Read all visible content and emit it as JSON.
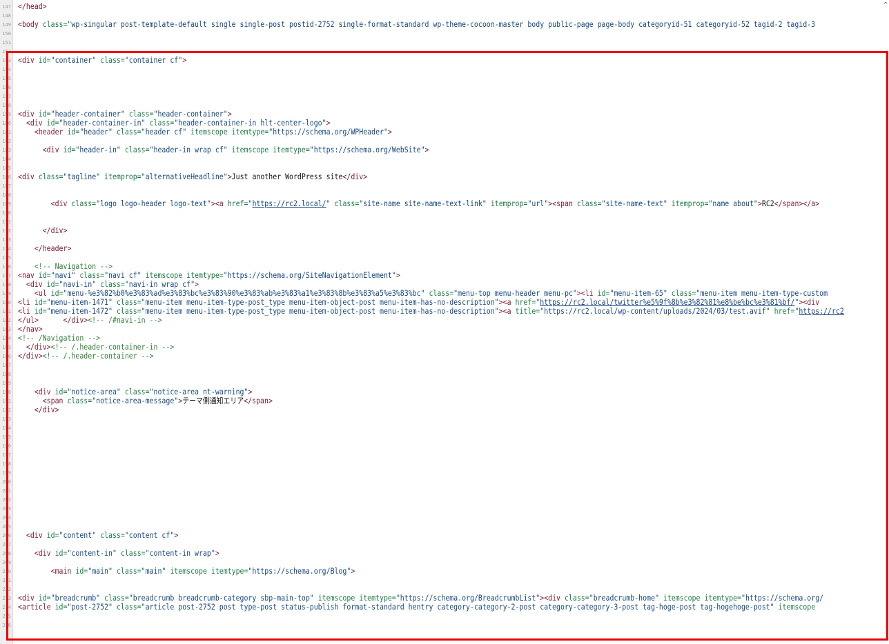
{
  "editor": {
    "highlight_color": "#ee0000",
    "colors": {
      "tag": "#7a1a2e",
      "attr": "#1c7a46",
      "value": "#17477e",
      "comment": "#2f7d35",
      "text": "#111111"
    },
    "scroll_indicator": "^",
    "line_numbers": [
      "147",
      "148",
      "149",
      "150",
      "151",
      "152",
      "153",
      "154",
      "155",
      "156",
      "157",
      "158",
      "159",
      "160",
      "161",
      "162",
      "163",
      "164",
      "165",
      "166",
      "167",
      "168",
      "169",
      "170",
      "171",
      "172",
      "173",
      "174",
      "175",
      "176",
      "177",
      "178",
      "179",
      "180",
      "181",
      "182",
      "183",
      "184",
      "185",
      "186",
      "187",
      "188",
      "189",
      "190",
      "191",
      "192",
      "193",
      "194",
      "195",
      "196",
      "197",
      "198",
      "199",
      "200",
      "201",
      "202",
      "203",
      "204",
      "205",
      "206",
      "207",
      "208",
      "209",
      "210",
      "211",
      "212",
      "213",
      "214",
      "215",
      "216",
      "217",
      "218"
    ],
    "lines": [
      [
        {
          "c": "t",
          "s": "</head>"
        }
      ],
      [],
      [
        {
          "c": "t",
          "s": "<body "
        },
        {
          "c": "a",
          "s": "class="
        },
        {
          "c": "v",
          "s": "\"wp-singular post-template-default single single-post postid-2752 single-format-standard wp-theme-cocoon-master body public-page page-body categoryid-51 categoryid-52 tagid-2 tagid-3"
        }
      ],
      [],
      [],
      [],
      [
        {
          "c": "t",
          "s": "<div "
        },
        {
          "c": "a",
          "s": "id="
        },
        {
          "c": "v",
          "s": "\"container\""
        },
        {
          "c": "a",
          "s": " class="
        },
        {
          "c": "v",
          "s": "\"container cf\""
        },
        {
          "c": "t",
          "s": ">"
        }
      ],
      [],
      [],
      [],
      [],
      [],
      [
        {
          "c": "t",
          "s": "<div "
        },
        {
          "c": "a",
          "s": "id="
        },
        {
          "c": "v",
          "s": "\"header-container\""
        },
        {
          "c": "a",
          "s": " class="
        },
        {
          "c": "v",
          "s": "\"header-container\""
        },
        {
          "c": "t",
          "s": ">"
        }
      ],
      [
        {
          "c": "t",
          "s": "  <div "
        },
        {
          "c": "a",
          "s": "id="
        },
        {
          "c": "v",
          "s": "\"header-container-in\""
        },
        {
          "c": "a",
          "s": " class="
        },
        {
          "c": "v",
          "s": "\"header-container-in hlt-center-logo\""
        },
        {
          "c": "t",
          "s": ">"
        }
      ],
      [
        {
          "c": "t",
          "s": "    <header "
        },
        {
          "c": "a",
          "s": "id="
        },
        {
          "c": "v",
          "s": "\"header\""
        },
        {
          "c": "a",
          "s": " class="
        },
        {
          "c": "v",
          "s": "\"header cf\""
        },
        {
          "c": "a",
          "s": " itemscope itemtype="
        },
        {
          "c": "v",
          "s": "\"https://schema.org/WPHeader\""
        },
        {
          "c": "t",
          "s": ">"
        }
      ],
      [],
      [
        {
          "c": "t",
          "s": "      <div "
        },
        {
          "c": "a",
          "s": "id="
        },
        {
          "c": "v",
          "s": "\"header-in\""
        },
        {
          "c": "a",
          "s": " class="
        },
        {
          "c": "v",
          "s": "\"header-in wrap cf\""
        },
        {
          "c": "a",
          "s": " itemscope itemtype="
        },
        {
          "c": "v",
          "s": "\"https://schema.org/WebSite\""
        },
        {
          "c": "t",
          "s": ">"
        }
      ],
      [],
      [],
      [
        {
          "c": "t",
          "s": "<div "
        },
        {
          "c": "a",
          "s": "class="
        },
        {
          "c": "v",
          "s": "\"tagline\""
        },
        {
          "c": "a",
          "s": " itemprop="
        },
        {
          "c": "v",
          "s": "\"alternativeHeadline\""
        },
        {
          "c": "t",
          "s": ">"
        },
        {
          "c": "txt",
          "s": "Just another WordPress site"
        },
        {
          "c": "t",
          "s": "</div>"
        }
      ],
      [],
      [],
      [
        {
          "c": "t",
          "s": "        <div "
        },
        {
          "c": "a",
          "s": "class="
        },
        {
          "c": "v",
          "s": "\"logo logo-header logo-text\""
        },
        {
          "c": "t",
          "s": "><a "
        },
        {
          "c": "a",
          "s": "href="
        },
        {
          "c": "v",
          "s": "\""
        },
        {
          "c": "url",
          "s": "https://rc2.local/"
        },
        {
          "c": "v",
          "s": "\""
        },
        {
          "c": "a",
          "s": " class="
        },
        {
          "c": "v",
          "s": "\"site-name site-name-text-link\""
        },
        {
          "c": "a",
          "s": " itemprop="
        },
        {
          "c": "v",
          "s": "\"url\""
        },
        {
          "c": "t",
          "s": "><span "
        },
        {
          "c": "a",
          "s": "class="
        },
        {
          "c": "v",
          "s": "\"site-name-text\""
        },
        {
          "c": "a",
          "s": " itemprop="
        },
        {
          "c": "v",
          "s": "\"name about\""
        },
        {
          "c": "t",
          "s": ">"
        },
        {
          "c": "txt",
          "s": "RC2"
        },
        {
          "c": "t",
          "s": "</span></a>"
        }
      ],
      [],
      [],
      [
        {
          "c": "t",
          "s": "      </div>"
        }
      ],
      [],
      [
        {
          "c": "t",
          "s": "    </header>"
        }
      ],
      [],
      [
        {
          "c": "cm",
          "s": "    <!-- Navigation -->"
        }
      ],
      [
        {
          "c": "t",
          "s": "<nav "
        },
        {
          "c": "a",
          "s": "id="
        },
        {
          "c": "v",
          "s": "\"navi\""
        },
        {
          "c": "a",
          "s": " class="
        },
        {
          "c": "v",
          "s": "\"navi cf\""
        },
        {
          "c": "a",
          "s": " itemscope itemtype="
        },
        {
          "c": "v",
          "s": "\"https://schema.org/SiteNavigationElement\""
        },
        {
          "c": "t",
          "s": ">"
        }
      ],
      [
        {
          "c": "t",
          "s": "  <div "
        },
        {
          "c": "a",
          "s": "id="
        },
        {
          "c": "v",
          "s": "\"navi-in\""
        },
        {
          "c": "a",
          "s": " class="
        },
        {
          "c": "v",
          "s": "\"navi-in wrap cf\""
        },
        {
          "c": "t",
          "s": ">"
        }
      ],
      [
        {
          "c": "t",
          "s": "    <ul "
        },
        {
          "c": "a",
          "s": "id="
        },
        {
          "c": "v",
          "s": "\"menu-%e3%82%b0%e3%83%ad%e3%83%bc%e3%83%90%e3%83%ab%e3%83%a1%e3%83%8b%e3%83%a5%e3%83%bc\""
        },
        {
          "c": "a",
          "s": " class="
        },
        {
          "c": "v",
          "s": "\"menu-top menu-header menu-pc\""
        },
        {
          "c": "t",
          "s": "><li "
        },
        {
          "c": "a",
          "s": "id="
        },
        {
          "c": "v",
          "s": "\"menu-item-65\""
        },
        {
          "c": "a",
          "s": " class="
        },
        {
          "c": "v",
          "s": "\"menu-item menu-item-type-custom"
        }
      ],
      [
        {
          "c": "t",
          "s": "<li "
        },
        {
          "c": "a",
          "s": "id="
        },
        {
          "c": "v",
          "s": "\"menu-item-1471\""
        },
        {
          "c": "a",
          "s": " class="
        },
        {
          "c": "v",
          "s": "\"menu-item menu-item-type-post_type menu-item-object-post menu-item-has-no-description\""
        },
        {
          "c": "t",
          "s": "><a "
        },
        {
          "c": "a",
          "s": "href="
        },
        {
          "c": "v",
          "s": "\""
        },
        {
          "c": "url",
          "s": "https://rc2.local/twitter%e5%9f%8b%e3%82%81%e8%be%bc%e3%81%bf/"
        },
        {
          "c": "v",
          "s": "\""
        },
        {
          "c": "t",
          "s": "><div"
        }
      ],
      [
        {
          "c": "t",
          "s": "<li "
        },
        {
          "c": "a",
          "s": "id="
        },
        {
          "c": "v",
          "s": "\"menu-item-1472\""
        },
        {
          "c": "a",
          "s": " class="
        },
        {
          "c": "v",
          "s": "\"menu-item menu-item-type-post_type menu-item-object-post menu-item-has-no-description\""
        },
        {
          "c": "t",
          "s": "><a "
        },
        {
          "c": "a",
          "s": "title="
        },
        {
          "c": "v",
          "s": "\"https://rc2.local/wp-content/uploads/2024/03/test.avif\""
        },
        {
          "c": "a",
          "s": " href="
        },
        {
          "c": "v",
          "s": "\""
        },
        {
          "c": "url",
          "s": "https://rc2"
        }
      ],
      [
        {
          "c": "t",
          "s": "</ul>      </div>"
        },
        {
          "c": "cm",
          "s": "<!-- /#navi-in -->"
        }
      ],
      [
        {
          "c": "t",
          "s": "</nav>"
        }
      ],
      [
        {
          "c": "cm",
          "s": "<!-- /Navigation -->"
        }
      ],
      [
        {
          "c": "t",
          "s": "  </div>"
        },
        {
          "c": "cm",
          "s": "<!-- /.header-container-in -->"
        }
      ],
      [
        {
          "c": "t",
          "s": "</div>"
        },
        {
          "c": "cm",
          "s": "<!-- /.header-container -->"
        }
      ],
      [],
      [],
      [],
      [
        {
          "c": "t",
          "s": "    <div "
        },
        {
          "c": "a",
          "s": "id="
        },
        {
          "c": "v",
          "s": "\"notice-area\""
        },
        {
          "c": "a",
          "s": " class="
        },
        {
          "c": "v",
          "s": "\"notice-area nt-warning\""
        },
        {
          "c": "t",
          "s": ">"
        }
      ],
      [
        {
          "c": "t",
          "s": "      <span "
        },
        {
          "c": "a",
          "s": "class="
        },
        {
          "c": "v",
          "s": "\"notice-area-message\""
        },
        {
          "c": "t",
          "s": ">"
        },
        {
          "c": "txt",
          "s": "テーマ側通知エリア"
        },
        {
          "c": "t",
          "s": "</span>"
        }
      ],
      [
        {
          "c": "t",
          "s": "    </div>"
        }
      ],
      [],
      [],
      [],
      [],
      [],
      [],
      [],
      [],
      [],
      [],
      [],
      [],
      [],
      [
        {
          "c": "t",
          "s": "  <div "
        },
        {
          "c": "a",
          "s": "id="
        },
        {
          "c": "v",
          "s": "\"content\""
        },
        {
          "c": "a",
          "s": " class="
        },
        {
          "c": "v",
          "s": "\"content cf\""
        },
        {
          "c": "t",
          "s": ">"
        }
      ],
      [],
      [
        {
          "c": "t",
          "s": "    <div "
        },
        {
          "c": "a",
          "s": "id="
        },
        {
          "c": "v",
          "s": "\"content-in\""
        },
        {
          "c": "a",
          "s": " class="
        },
        {
          "c": "v",
          "s": "\"content-in wrap\""
        },
        {
          "c": "t",
          "s": ">"
        }
      ],
      [],
      [
        {
          "c": "t",
          "s": "        <main "
        },
        {
          "c": "a",
          "s": "id="
        },
        {
          "c": "v",
          "s": "\"main\""
        },
        {
          "c": "a",
          "s": " class="
        },
        {
          "c": "v",
          "s": "\"main\""
        },
        {
          "c": "a",
          "s": " itemscope itemtype="
        },
        {
          "c": "v",
          "s": "\"https://schema.org/Blog\""
        },
        {
          "c": "t",
          "s": ">"
        }
      ],
      [],
      [],
      [
        {
          "c": "t",
          "s": "<div "
        },
        {
          "c": "a",
          "s": "id="
        },
        {
          "c": "v",
          "s": "\"breadcrumb\""
        },
        {
          "c": "a",
          "s": " class="
        },
        {
          "c": "v",
          "s": "\"breadcrumb breadcrumb-category sbp-main-top\""
        },
        {
          "c": "a",
          "s": " itemscope itemtype="
        },
        {
          "c": "v",
          "s": "\"https://schema.org/BreadcrumbList\""
        },
        {
          "c": "t",
          "s": "><div "
        },
        {
          "c": "a",
          "s": "class="
        },
        {
          "c": "v",
          "s": "\"breadcrumb-home\""
        },
        {
          "c": "a",
          "s": " itemscope itemtype="
        },
        {
          "c": "v",
          "s": "\"https://schema.org/"
        }
      ],
      [
        {
          "c": "t",
          "s": "<article "
        },
        {
          "c": "a",
          "s": "id="
        },
        {
          "c": "v",
          "s": "\"post-2752\""
        },
        {
          "c": "a",
          "s": " class="
        },
        {
          "c": "v",
          "s": "\"article post-2752 post type-post status-publish format-standard hentry category-category-2-post category-category-3-post tag-hoge-post tag-hogehoge-post\""
        },
        {
          "c": "a",
          "s": " itemscope"
        }
      ],
      [],
      []
    ]
  }
}
